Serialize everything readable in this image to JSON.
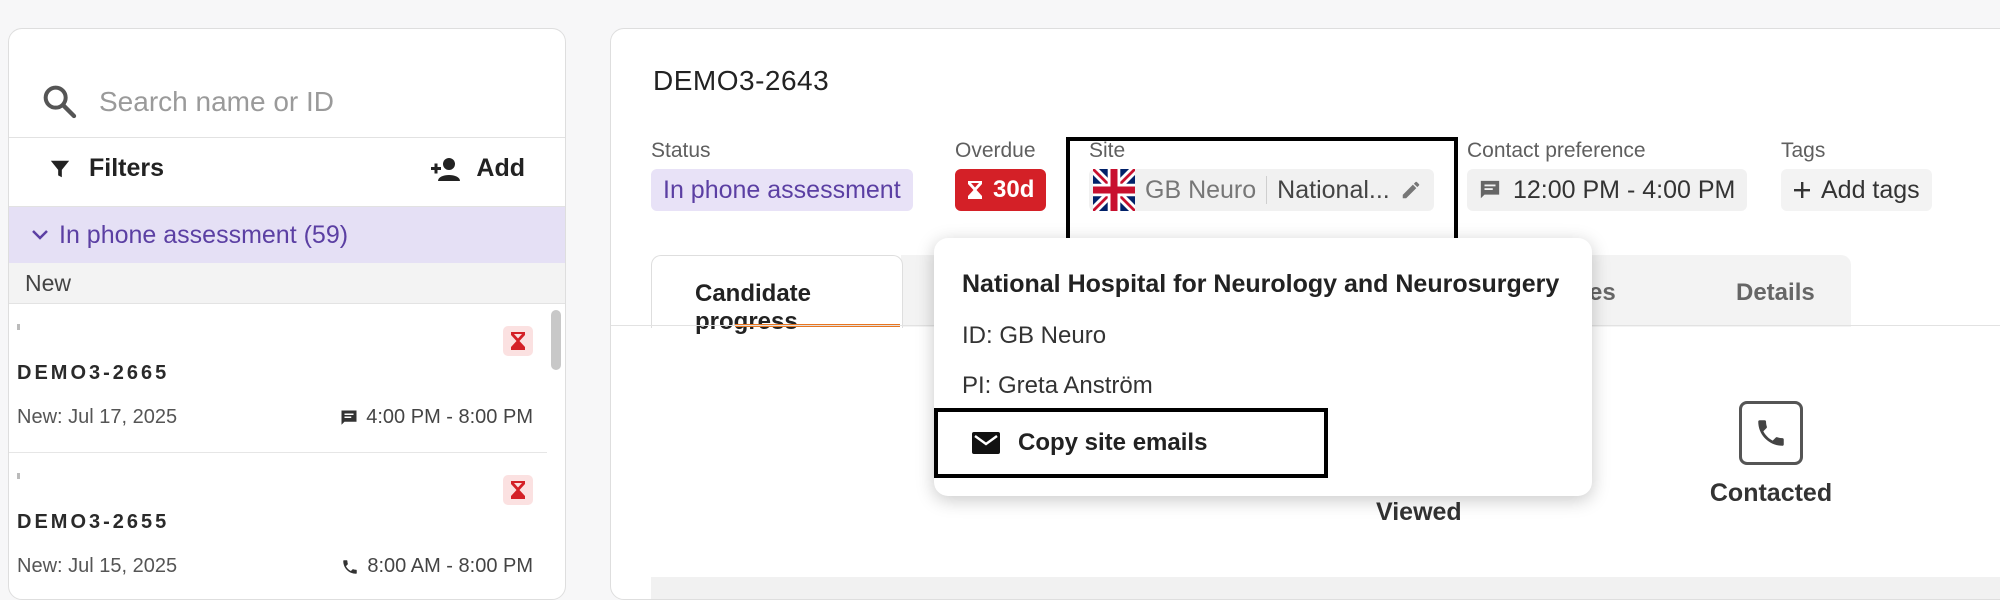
{
  "search": {
    "placeholder": "Search name or ID",
    "value": ""
  },
  "toolbar": {
    "filters_label": "Filters",
    "add_label": "Add"
  },
  "group": {
    "label": "In phone assessment (59)"
  },
  "list": {
    "section_label": "New",
    "items": [
      {
        "id": "DEMO3-2665",
        "date": "New: Jul 17, 2025",
        "contact": "4:00 PM - 8:00 PM",
        "contact_icon": "message-icon"
      },
      {
        "id": "DEMO3-2655",
        "date": "New: Jul 15, 2025",
        "contact": "8:00 AM - 8:00 PM",
        "contact_icon": "phone-icon"
      }
    ]
  },
  "record": {
    "id": "DEMO3-2643",
    "status_label": "Status",
    "status_value": "In phone assessment",
    "overdue_label": "Overdue",
    "overdue_value": "30d",
    "site_label": "Site",
    "site_code": "GB Neuro",
    "site_name_short": "National...",
    "contact_label": "Contact preference",
    "contact_value": "12:00 PM - 4:00 PM",
    "tags_label": "Tags",
    "tags_action": "Add tags"
  },
  "tabs": [
    {
      "label": "Candidate progress",
      "active": true
    },
    {
      "label": "...ages",
      "active": false
    },
    {
      "label": "Details",
      "active": false
    }
  ],
  "steps": [
    {
      "label": "Viewed"
    },
    {
      "label": "Contacted"
    }
  ],
  "popover": {
    "title": "National Hospital for Neurology and Neurosurgery",
    "id_line": "ID: GB Neuro",
    "pi_line": "PI: Greta Anström",
    "copy_label": "Copy site emails"
  },
  "colors": {
    "accent_purple": "#5b3fa3",
    "status_bg": "#e8e2f7",
    "overdue_red": "#d42027",
    "tab_underline": "#e87722"
  }
}
